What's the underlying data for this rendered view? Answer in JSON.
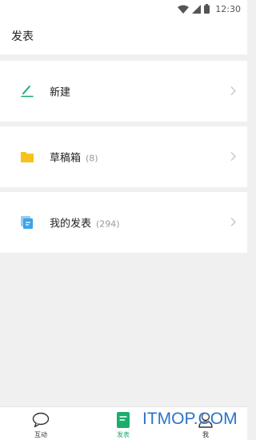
{
  "status_bar": {
    "time": "12:30"
  },
  "header": {
    "title": "发表"
  },
  "list": [
    {
      "label": "新建",
      "count": "",
      "icon": "pencil-icon",
      "icon_color": "#1aad6e"
    },
    {
      "label": "草稿箱",
      "count": "(8)",
      "icon": "folder-icon",
      "icon_color": "#f7c31a"
    },
    {
      "label": "我的发表",
      "count": "(294)",
      "icon": "documents-icon",
      "icon_color": "#3aa5e8"
    }
  ],
  "bottom_nav": [
    {
      "label": "互动",
      "icon": "speech-bubble-icon",
      "active": false
    },
    {
      "label": "发表",
      "icon": "post-icon",
      "active": true
    },
    {
      "label": "我",
      "icon": "person-icon",
      "active": false
    }
  ],
  "watermark": "ITMOP.COM",
  "colors": {
    "accent": "#1aad6e",
    "background": "#f0f0f0"
  }
}
